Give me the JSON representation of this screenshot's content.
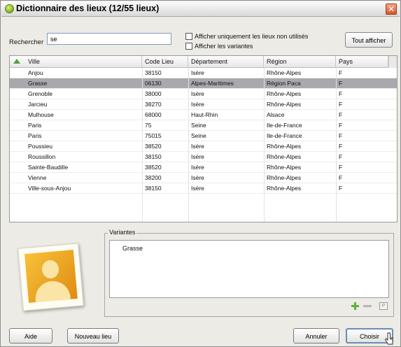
{
  "window": {
    "title": "Dictionnaire des lieux (12/55 lieux)",
    "close_glyph": "✕"
  },
  "search": {
    "label": "Rechercher",
    "value": "se"
  },
  "options": {
    "unused_only": "Afficher uniquement les lieux non utilisés",
    "show_variants": "Afficher les variantes"
  },
  "buttons": {
    "show_all": "Tout afficher",
    "help": "Aide",
    "new_place": "Nouveau lieu",
    "cancel": "Annuler",
    "choose": "Choisir"
  },
  "table": {
    "columns": [
      "Ville",
      "Code Lieu",
      "Département",
      "Région",
      "Pays"
    ],
    "sort_icon": "sort-ascending-icon",
    "selected_row": 1,
    "rows": [
      [
        "Anjou",
        "38150",
        "Isère",
        "Rhône-Alpes",
        "F"
      ],
      [
        "Grasse",
        "06130",
        "Alpes-Maritimes",
        "Région Paca",
        "F"
      ],
      [
        "Grenoble",
        "38000",
        "Isère",
        "Rhône-Alpes",
        "F"
      ],
      [
        "Jarcieu",
        "38270",
        "Isère",
        "Rhône-Alpes",
        "F"
      ],
      [
        "Mulhouse",
        "68000",
        "Haut-Rhin",
        "Alsace",
        "F"
      ],
      [
        "Paris",
        "75",
        "Seine",
        "Ile-de-France",
        "F"
      ],
      [
        "Paris",
        "75015",
        "Seine",
        "Ile-de-France",
        "F"
      ],
      [
        "Poussieu",
        "38520",
        "Isère",
        "Rhône-Alpes",
        "F"
      ],
      [
        "Roussillon",
        "38150",
        "Isère",
        "Rhône-Alpes",
        "F"
      ],
      [
        "Sainte-Baudille",
        "38520",
        "Isère",
        "Rhône-Alpes",
        "F"
      ],
      [
        "Vienne",
        "38200",
        "Isère",
        "Rhône-Alpes",
        "F"
      ],
      [
        "Ville-sous-Anjou",
        "38150",
        "Isère",
        "Rhône-Alpes",
        "F"
      ]
    ]
  },
  "variantes": {
    "legend": "Variantes",
    "items": [
      "Grasse"
    ]
  },
  "icons": {
    "add": "add-icon",
    "remove": "remove-icon",
    "edit": "edit-icon",
    "photo": "photo-placeholder-icon",
    "edit_glyph": "P"
  },
  "colors": {
    "selection": "#a9a9ad",
    "add_green": "#5bb33b",
    "default_button_border": "#6d8db3"
  }
}
